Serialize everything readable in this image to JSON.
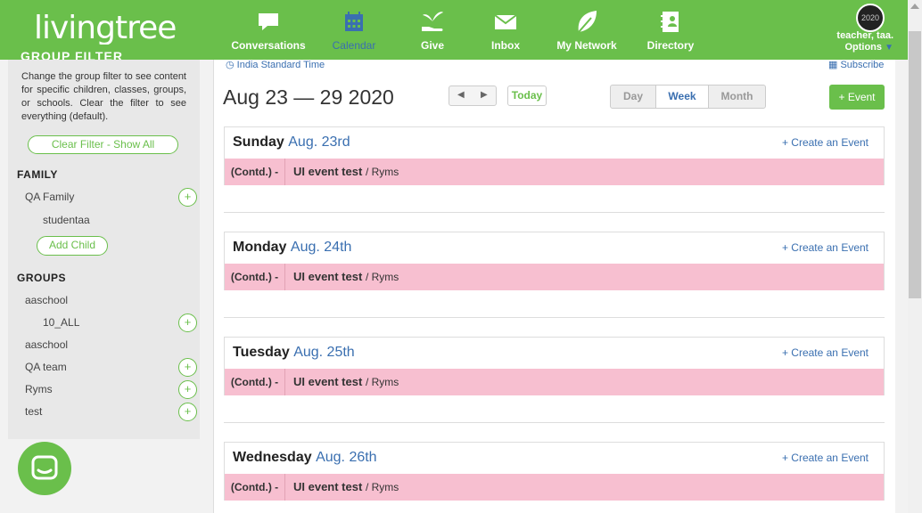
{
  "brand": {
    "logo_text": "livingtree"
  },
  "nav": [
    {
      "label": "Conversations",
      "icon": "chat-bubble-icon"
    },
    {
      "label": "Calendar",
      "icon": "calendar-icon",
      "active": true
    },
    {
      "label": "Give",
      "icon": "hand-plant-icon"
    },
    {
      "label": "Inbox",
      "icon": "envelope-icon"
    },
    {
      "label": "My Network",
      "icon": "leaf-icon"
    },
    {
      "label": "Directory",
      "icon": "directory-icon"
    }
  ],
  "profile": {
    "avatar_text": "2020",
    "name": "teacher, taa.",
    "options_label": "Options"
  },
  "sidebar": {
    "header": "GROUP FILTER",
    "description": "Change the group filter to see content for specific children, classes, groups, or schools. Clear the filter to see everything (default).",
    "clear_filter_label": "Clear Filter - Show All",
    "family_heading": "FAMILY",
    "family_items": [
      {
        "label": "QA Family"
      },
      {
        "label": "studentaa"
      }
    ],
    "add_child_label": "Add Child",
    "groups_heading": "GROUPS",
    "group_items": [
      {
        "label": "aaschool"
      },
      {
        "label": "10_ALL"
      },
      {
        "label": "aaschool"
      },
      {
        "label": "QA team"
      },
      {
        "label": "Ryms"
      },
      {
        "label": "test"
      }
    ],
    "plus_symbol": "+"
  },
  "calendar": {
    "timezone": "India Standard Time",
    "subscribe_label": "Subscribe",
    "range_title": "Aug 23 — 29 2020",
    "prev_symbol": "◀",
    "next_symbol": "▶",
    "today_label": "Today",
    "views": [
      "Day",
      "Week",
      "Month"
    ],
    "active_view": "Week",
    "add_event_label": "+ Event",
    "create_label": "+ Create an Event",
    "days": [
      {
        "weekday": "Sunday",
        "date": "Aug. 23rd",
        "event": {
          "contd": "(Contd.) -",
          "title": "UI event test",
          "group": "/ Ryms"
        }
      },
      {
        "weekday": "Monday",
        "date": "Aug. 24th",
        "event": {
          "contd": "(Contd.) -",
          "title": "UI event test",
          "group": "/ Ryms"
        }
      },
      {
        "weekday": "Tuesday",
        "date": "Aug. 25th",
        "event": {
          "contd": "(Contd.) -",
          "title": "UI event test",
          "group": "/ Ryms"
        }
      },
      {
        "weekday": "Wednesday",
        "date": "Aug. 26th",
        "event": {
          "contd": "(Contd.) -",
          "title": "UI event test",
          "group": "/ Ryms"
        }
      }
    ]
  },
  "colors": {
    "brand_green": "#6abf4b",
    "link_blue": "#3a6fb0",
    "event_pink": "#f7bfd0"
  }
}
